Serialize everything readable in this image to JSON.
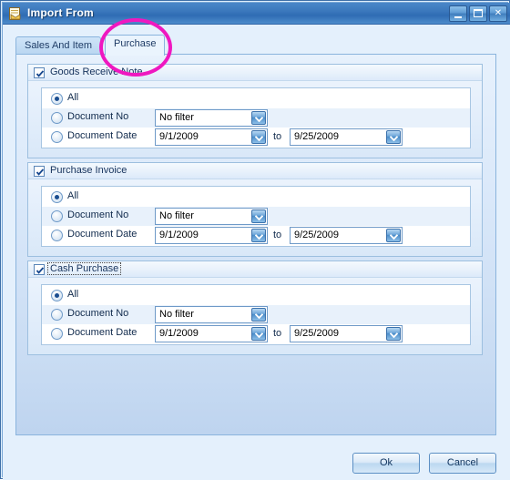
{
  "window": {
    "title": "Import From",
    "icon": "document-import-icon",
    "controls": {
      "minimize": "Minimize",
      "maximize": "Maximize",
      "close": "Close",
      "close_glyph": "✕"
    }
  },
  "tabs": [
    {
      "label": "Sales And Item",
      "active": false
    },
    {
      "label": "Purchase",
      "active": true
    }
  ],
  "groups": [
    {
      "title": "Goods Receive Note",
      "checked": true,
      "title_focused": false,
      "options": {
        "all": "All",
        "document_no": "Document No",
        "document_date": "Document Date"
      },
      "selected": "all",
      "filter_value": "No filter",
      "date_from": "9/1/2009",
      "date_to": "9/25/2009",
      "to_label": "to"
    },
    {
      "title": "Purchase Invoice",
      "checked": true,
      "title_focused": false,
      "options": {
        "all": "All",
        "document_no": "Document No",
        "document_date": "Document Date"
      },
      "selected": "all",
      "filter_value": "No filter",
      "date_from": "9/1/2009",
      "date_to": "9/25/2009",
      "to_label": "to"
    },
    {
      "title": "Cash Purchase",
      "checked": true,
      "title_focused": true,
      "options": {
        "all": "All",
        "document_no": "Document No",
        "document_date": "Document Date"
      },
      "selected": "all",
      "filter_value": "No filter",
      "date_from": "9/1/2009",
      "date_to": "9/25/2009",
      "to_label": "to"
    }
  ],
  "footer": {
    "ok_label": "Ok",
    "cancel_label": "Cancel"
  },
  "annotation": {
    "type": "ellipse-highlight",
    "color": "#ef18c0",
    "target": "Purchase"
  }
}
